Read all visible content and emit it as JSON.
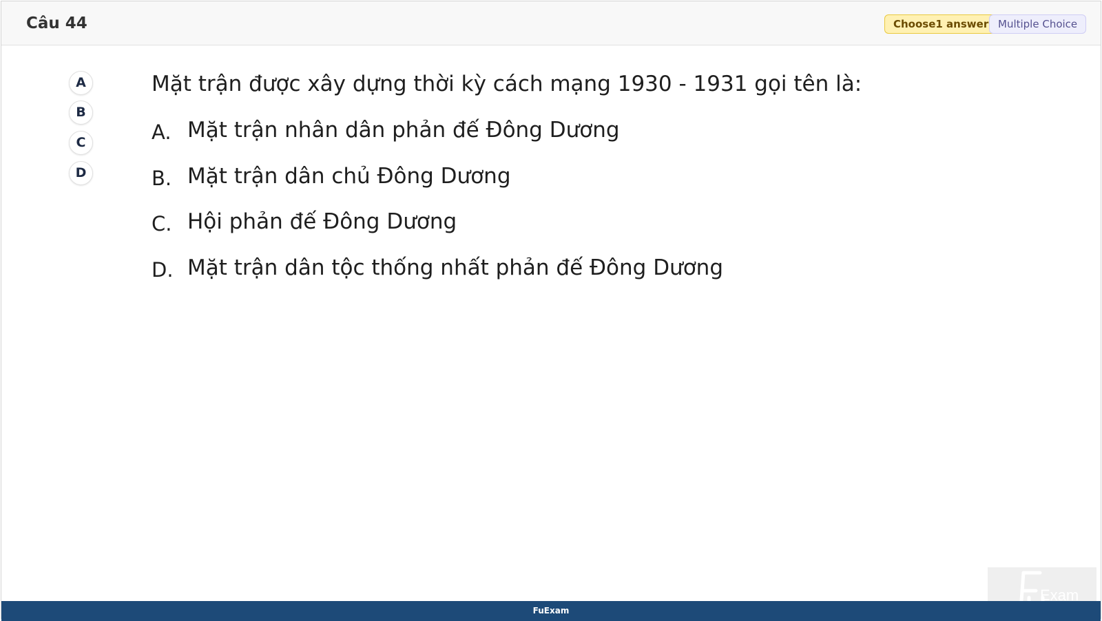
{
  "header": {
    "question_number": "Câu 44",
    "choose_badge": "Choose1 answer",
    "type_badge": "Multiple Choice"
  },
  "answer_buttons": [
    "A",
    "B",
    "C",
    "D"
  ],
  "question": {
    "text": "Mặt trận được xây dựng thời kỳ cách mạng 1930 - 1931 gọi tên là:",
    "options": [
      {
        "letter": "A.",
        "text": "Mặt trận nhân dân phản đế Đông Dương"
      },
      {
        "letter": "B.",
        "text": "Mặt trận dân chủ Đông Dương"
      },
      {
        "letter": "C.",
        "text": "Hội phản đế Đông Dương"
      },
      {
        "letter": "D.",
        "text": "Mặt trận dân tộc thống nhất phản đế Đông Dương"
      }
    ]
  },
  "footer": {
    "brand": "FuExam"
  },
  "colors": {
    "footer_bg": "#1d4a78",
    "choose_badge_bg": "#fff1b3",
    "type_badge_bg": "#eeeefc"
  }
}
